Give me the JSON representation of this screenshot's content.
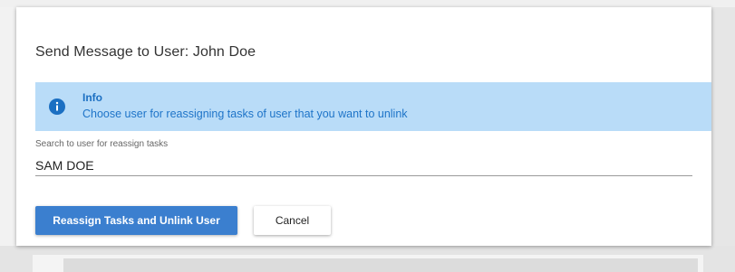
{
  "dialog": {
    "title": "Send Message to User: John Doe"
  },
  "info": {
    "icon": "info-circle-icon",
    "title": "Info",
    "message": "Choose user for reassigning tasks of user that you want to unlink",
    "colors": {
      "background": "#b9dcf8",
      "accent": "#1b6fc2"
    }
  },
  "search": {
    "label": "Search to user for reassign tasks",
    "value": "SAM DOE"
  },
  "actions": {
    "reassign_label": "Reassign Tasks and Unlink User",
    "cancel_label": "Cancel",
    "primary_color": "#3b7fcf"
  }
}
